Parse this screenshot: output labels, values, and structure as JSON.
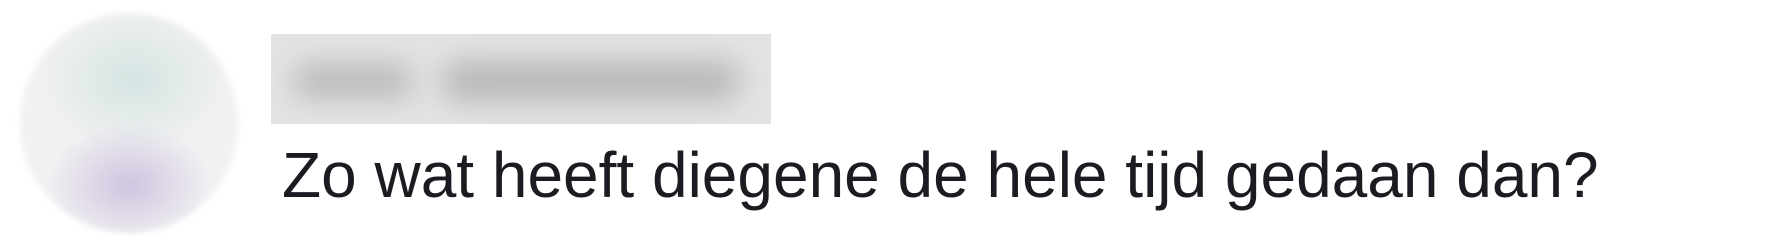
{
  "comment": {
    "text": "Zo wat heeft diegene de hele tijd gedaan dan?"
  },
  "colors": {
    "text": "#1c1b22",
    "background": "#ffffff"
  }
}
